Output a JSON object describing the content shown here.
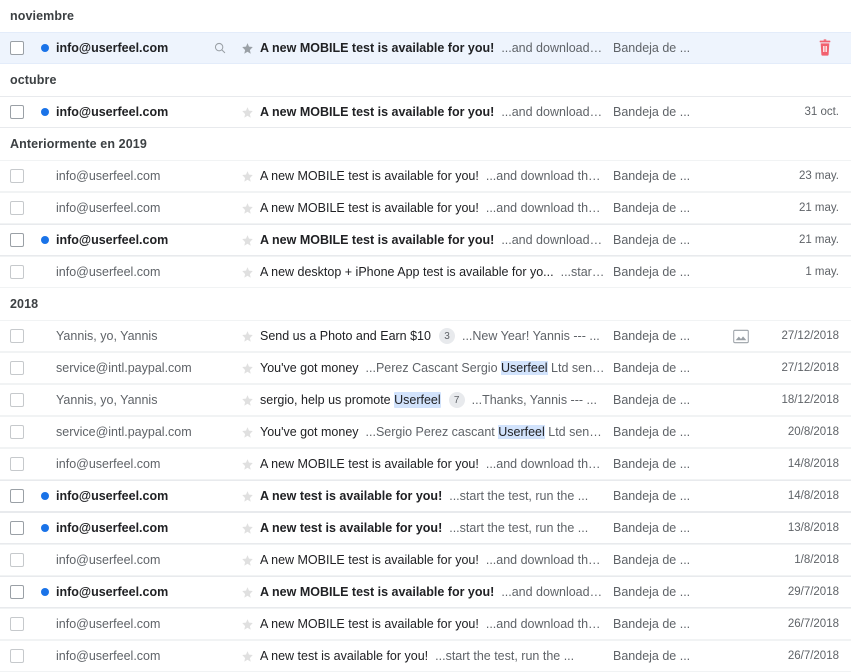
{
  "colors": {
    "unread_dot": "#1a73e8",
    "hover_row_bg": "#eef4fd",
    "highlight_bg": "#d2e3fc",
    "trash_icon": "#f2616f",
    "star_default": "#e0e0e0",
    "star_hover": "#9aa0a6",
    "text_primary": "#202124",
    "text_secondary": "#5f6368"
  },
  "folder_label": "Bandeja de ...",
  "groups": [
    {
      "label": "noviembre",
      "rows": [
        {
          "unread": true,
          "hovered": true,
          "sender": "info@userfeel.com",
          "search_icon": "search-icon",
          "star": "star-icon",
          "subject": "A new MOBILE test is available for you!",
          "preview": "...and download t...",
          "folder": "Bandeja de ...",
          "attachment": "",
          "date": "",
          "action_icon": "trash-icon"
        }
      ]
    },
    {
      "label": "octubre",
      "rows": [
        {
          "unread": true,
          "hovered": false,
          "sender": "info@userfeel.com",
          "search_icon": "",
          "star": "star-icon",
          "subject": "A new MOBILE test is available for you!",
          "preview": "...and download t...",
          "folder": "Bandeja de ...",
          "attachment": "",
          "date": "31 oct.",
          "action_icon": ""
        }
      ]
    },
    {
      "label": "Anteriormente en 2019",
      "rows": [
        {
          "unread": false,
          "hovered": false,
          "sender": "info@userfeel.com",
          "search_icon": "",
          "star": "star-icon",
          "subject": "A new MOBILE test is available for you!",
          "preview": "...and download the ...",
          "folder": "Bandeja de ...",
          "attachment": "",
          "date": "23 may.",
          "action_icon": ""
        },
        {
          "unread": false,
          "hovered": false,
          "sender": "info@userfeel.com",
          "search_icon": "",
          "star": "star-icon",
          "subject": "A new MOBILE test is available for you!",
          "preview": "...and download the ...",
          "folder": "Bandeja de ...",
          "attachment": "",
          "date": "21 may.",
          "action_icon": ""
        },
        {
          "unread": true,
          "hovered": false,
          "sender": "info@userfeel.com",
          "search_icon": "",
          "star": "star-icon",
          "subject": "A new MOBILE test is available for you!",
          "preview": "...and download t...",
          "folder": "Bandeja de ...",
          "attachment": "",
          "date": "21 may.",
          "action_icon": ""
        },
        {
          "unread": false,
          "hovered": false,
          "sender": "info@userfeel.com",
          "search_icon": "",
          "star": "star-icon",
          "subject": "A new desktop + iPhone App test is available for yo...",
          "preview": "...start ...",
          "folder": "Bandeja de ...",
          "attachment": "",
          "date": "1 may.",
          "action_icon": ""
        }
      ]
    },
    {
      "label": "2018",
      "rows": [
        {
          "unread": false,
          "hovered": false,
          "sender": "Yannis, yo, Yannis",
          "search_icon": "",
          "star": "star-icon",
          "subject": "Send us a Photo and Earn $10",
          "count": "3",
          "preview": "...New Year! Yannis --- ...",
          "folder": "Bandeja de ...",
          "attachment": "image-attachment-icon",
          "date": "27/12/2018",
          "action_icon": ""
        },
        {
          "unread": false,
          "hovered": false,
          "sender": "service@intl.paypal.com",
          "search_icon": "",
          "star": "star-icon",
          "subject": "You've got money",
          "preview_parts": [
            {
              "text": "...Perez Cascant Sergio ",
              "highlight": false
            },
            {
              "text": "Userfeel",
              "highlight": true
            },
            {
              "text": " Ltd sent y...",
              "highlight": false
            }
          ],
          "folder": "Bandeja de ...",
          "attachment": "",
          "date": "27/12/2018",
          "action_icon": ""
        },
        {
          "unread": false,
          "hovered": false,
          "sender": "Yannis, yo, Yannis",
          "search_icon": "",
          "star": "star-icon",
          "subject_parts": [
            {
              "text": "sergio, help us promote ",
              "highlight": false
            },
            {
              "text": "Userfeel",
              "highlight": true
            }
          ],
          "count": "7",
          "preview": "...Thanks, Yannis --- ...",
          "folder": "Bandeja de ...",
          "attachment": "",
          "date": "18/12/2018",
          "action_icon": ""
        },
        {
          "unread": false,
          "hovered": false,
          "sender": "service@intl.paypal.com",
          "search_icon": "",
          "star": "star-icon",
          "subject": "You've got money",
          "preview_parts": [
            {
              "text": "...Sergio Perez cascant ",
              "highlight": false
            },
            {
              "text": "Userfeel",
              "highlight": true
            },
            {
              "text": " Ltd sent y...",
              "highlight": false
            }
          ],
          "folder": "Bandeja de ...",
          "attachment": "",
          "date": "20/8/2018",
          "action_icon": ""
        },
        {
          "unread": false,
          "hovered": false,
          "sender": "info@userfeel.com",
          "search_icon": "",
          "star": "star-icon",
          "subject": "A new MOBILE test is available for you!",
          "preview": "...and download the ...",
          "folder": "Bandeja de ...",
          "attachment": "",
          "date": "14/8/2018",
          "action_icon": ""
        },
        {
          "unread": true,
          "hovered": false,
          "sender": "info@userfeel.com",
          "search_icon": "",
          "star": "star-icon",
          "subject": "A new test is available for you!",
          "preview": "...start the test, run the ...",
          "folder": "Bandeja de ...",
          "attachment": "",
          "date": "14/8/2018",
          "action_icon": ""
        },
        {
          "unread": true,
          "hovered": false,
          "sender": "info@userfeel.com",
          "search_icon": "",
          "star": "star-icon",
          "subject": "A new test is available for you!",
          "preview": "...start the test, run the ...",
          "folder": "Bandeja de ...",
          "attachment": "",
          "date": "13/8/2018",
          "action_icon": ""
        },
        {
          "unread": false,
          "hovered": false,
          "sender": "info@userfeel.com",
          "search_icon": "",
          "star": "star-icon",
          "subject": "A new MOBILE test is available for you!",
          "preview": "...and download the ...",
          "folder": "Bandeja de ...",
          "attachment": "",
          "date": "1/8/2018",
          "action_icon": ""
        },
        {
          "unread": true,
          "hovered": false,
          "sender": "info@userfeel.com",
          "search_icon": "",
          "star": "star-icon",
          "subject": "A new MOBILE test is available for you!",
          "preview": "...and download t...",
          "folder": "Bandeja de ...",
          "attachment": "",
          "date": "29/7/2018",
          "action_icon": ""
        },
        {
          "unread": false,
          "hovered": false,
          "sender": "info@userfeel.com",
          "search_icon": "",
          "star": "star-icon",
          "subject": "A new MOBILE test is available for you!",
          "preview": "...and download the ...",
          "folder": "Bandeja de ...",
          "attachment": "",
          "date": "26/7/2018",
          "action_icon": ""
        },
        {
          "unread": false,
          "hovered": false,
          "sender": "info@userfeel.com",
          "search_icon": "",
          "star": "star-icon",
          "subject": "A new test is available for you!",
          "preview": "...start the test, run the ...",
          "folder": "Bandeja de ...",
          "attachment": "",
          "date": "26/7/2018",
          "action_icon": ""
        }
      ]
    }
  ]
}
